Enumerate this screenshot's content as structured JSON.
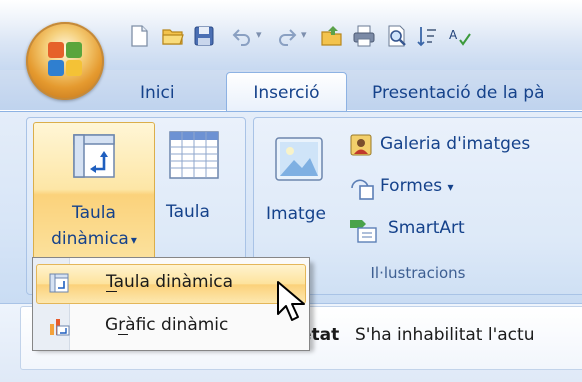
{
  "tabs": [
    "Inici",
    "Inserció",
    "Presentació de la pà"
  ],
  "active_tab": "Inserció",
  "tables_group": {
    "pivot_button_label_line1": "Taula",
    "pivot_button_label_line2": "dinàmica",
    "dropdown_arrow": "▾",
    "table_button_label": "Taula"
  },
  "illustrations_group": {
    "label": "Il·lustracions",
    "image_button_label": "Imatge",
    "clipart_label": "Galeria d'imatges",
    "shapes_label": "Formes",
    "shapes_arrow": "▾",
    "smartart_label": "SmartArt"
  },
  "pivot_menu": {
    "items": [
      {
        "label": "Taula dinàmica",
        "icon": "pivot-table-icon"
      },
      {
        "label": "Gràfic dinàmic",
        "icon": "pivot-chart-icon"
      }
    ]
  },
  "message_bar": {
    "label": "etat",
    "text": "S'ha inhabilitat l'actu"
  },
  "colors": {
    "tab_text": "#15428b",
    "ribbon_bg": "#dbe7f7",
    "menu_highlight": "#fde39c",
    "button_highlight": "#fbd27b"
  }
}
